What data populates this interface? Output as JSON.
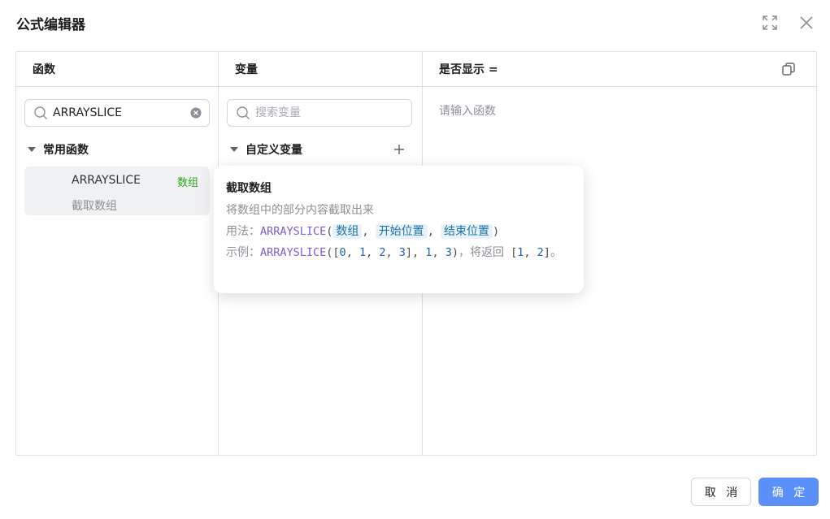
{
  "dialog": {
    "title": "公式编辑器",
    "buttons": {
      "cancel": "取 消",
      "ok": "确 定"
    }
  },
  "functions_panel": {
    "header": "函数",
    "search": {
      "value": "ARRAYSLICE",
      "placeholder": ""
    },
    "group": "常用函数",
    "items": [
      {
        "name": "ARRAYSLICE",
        "description": "截取数组",
        "tag": "数组"
      }
    ]
  },
  "variables_panel": {
    "header": "变量",
    "search": {
      "placeholder": "搜索变量"
    },
    "group": "自定义变量"
  },
  "editor_panel": {
    "header": "是否显示 =",
    "placeholder": "请输入函数"
  },
  "tooltip": {
    "title": "截取数组",
    "description": "将数组中的部分内容截取出来",
    "usage_label": "用法：",
    "usage_fn": "ARRAYSLICE",
    "usage_args": [
      "数组",
      "开始位置",
      "结束位置"
    ],
    "example_label": "示例：",
    "example_fn": "ARRAYSLICE",
    "example_array": [
      "0",
      "1",
      "2",
      "3"
    ],
    "example_params": [
      "1",
      "3"
    ],
    "example_returns": "，将返回",
    "result_values": [
      "1",
      "2"
    ],
    "period": "。"
  },
  "colors": {
    "primary": "#5b8ff9",
    "tag_green": "#2ea121",
    "function_purple": "#7c5bd6"
  }
}
